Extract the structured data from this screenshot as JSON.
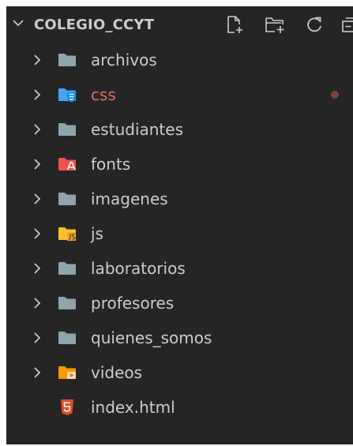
{
  "explorer": {
    "title": "COLEGIO_CCYT",
    "actions": [
      {
        "name": "new-file-button",
        "icon": "new-file-icon"
      },
      {
        "name": "new-folder-button",
        "icon": "new-folder-icon"
      },
      {
        "name": "refresh-button",
        "icon": "refresh-icon"
      },
      {
        "name": "collapse-all-button",
        "icon": "collapse-all-icon"
      }
    ],
    "items": [
      {
        "label": "archivos",
        "kind": "folder",
        "icon": "folder-icon",
        "color": "#90a4ae"
      },
      {
        "label": "css",
        "kind": "folder",
        "icon": "css-folder-icon",
        "color": "#42a5f5",
        "modified": true
      },
      {
        "label": "estudiantes",
        "kind": "folder",
        "icon": "folder-icon",
        "color": "#90a4ae"
      },
      {
        "label": "fonts",
        "kind": "folder",
        "icon": "font-folder-icon",
        "color": "#ef5350"
      },
      {
        "label": "imagenes",
        "kind": "folder",
        "icon": "folder-icon",
        "color": "#90a4ae"
      },
      {
        "label": "js",
        "kind": "folder",
        "icon": "js-folder-icon",
        "color": "#fbc02d"
      },
      {
        "label": "laboratorios",
        "kind": "folder",
        "icon": "folder-icon",
        "color": "#90a4ae"
      },
      {
        "label": "profesores",
        "kind": "folder",
        "icon": "folder-icon",
        "color": "#90a4ae"
      },
      {
        "label": "quienes_somos",
        "kind": "folder",
        "icon": "folder-icon",
        "color": "#90a4ae"
      },
      {
        "label": "videos",
        "kind": "folder",
        "icon": "video-folder-icon",
        "color": "#ff9800"
      },
      {
        "label": "index.html",
        "kind": "file",
        "icon": "html5-icon",
        "color": "#e44d26"
      }
    ]
  },
  "colors": {
    "panel_background": "#252526",
    "text": "#cccccc",
    "modified_text": "#e06c5a",
    "modified_dot": "#7a4538"
  }
}
